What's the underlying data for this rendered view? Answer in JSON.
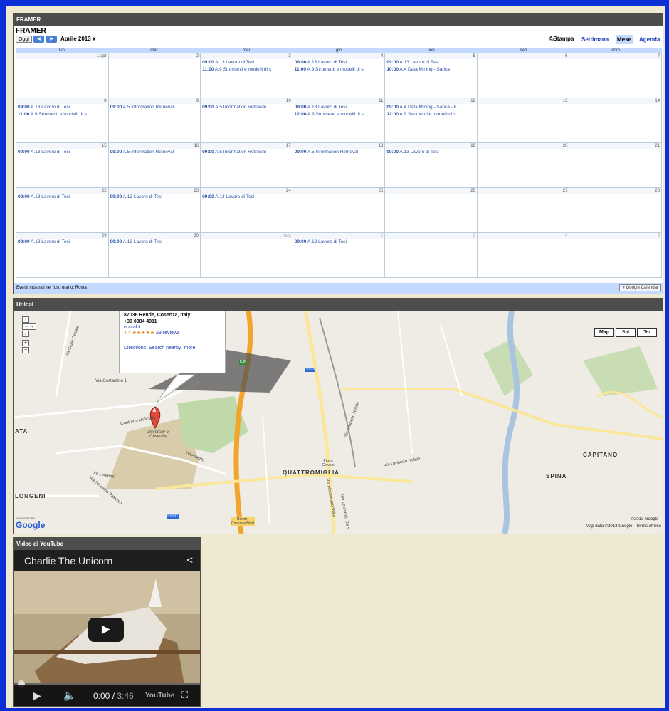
{
  "calendar": {
    "header": "FRAMER",
    "title": "FRAMER",
    "today_label": "Oggi",
    "month_label": "Aprile 2013",
    "print_label": "Stampa",
    "views": [
      "Settimana",
      "Mese",
      "Agenda"
    ],
    "active_view": "Mese",
    "weekdays": [
      "lun",
      "mar",
      "mer",
      "gio",
      "ven",
      "sab",
      "dom"
    ],
    "weeks": [
      [
        {
          "num": "1 apr",
          "events": []
        },
        {
          "num": "2",
          "events": []
        },
        {
          "num": "3",
          "events": [
            {
              "time": "09:00",
              "title": "A.13 Lavoro di Tesi"
            },
            {
              "time": "11:00",
              "title": "A.9 Strumenti e modelli di s"
            }
          ]
        },
        {
          "num": "4",
          "events": [
            {
              "time": "09:00",
              "title": "A.13 Lavoro di Tesi"
            },
            {
              "time": "11:00",
              "title": "A.9 Strumenti e modelli di s"
            }
          ]
        },
        {
          "num": "5",
          "events": [
            {
              "time": "09:00",
              "title": "A.13 Lavoro di Tesi"
            },
            {
              "time": "10:00",
              "title": "A.4 Data Mining - Sarica"
            }
          ]
        },
        {
          "num": "6",
          "events": []
        },
        {
          "num": "7",
          "events": []
        }
      ],
      [
        {
          "num": "8",
          "events": [
            {
              "time": "09:00",
              "title": "A.13 Lavoro di Tesi"
            },
            {
              "time": "11:00",
              "title": "A.9 Strumenti e modelli di s"
            }
          ]
        },
        {
          "num": "9",
          "events": [
            {
              "time": "09:00",
              "title": "A.5 Information Retrieval"
            }
          ]
        },
        {
          "num": "10",
          "events": [
            {
              "time": "09:00",
              "title": "A.5 Information Retrieval"
            }
          ]
        },
        {
          "num": "11",
          "events": [
            {
              "time": "09:00",
              "title": "A.13 Lavoro di Tesi"
            },
            {
              "time": "12:00",
              "title": "A.9 Strumenti e modelli di s"
            }
          ]
        },
        {
          "num": "12",
          "events": [
            {
              "time": "09:00",
              "title": "A.4 Data Mining - Sarica - F"
            },
            {
              "time": "12:00",
              "title": "A.9 Strumenti e modelli di s"
            }
          ]
        },
        {
          "num": "13",
          "events": []
        },
        {
          "num": "14",
          "events": []
        }
      ],
      [
        {
          "num": "15",
          "events": [
            {
              "time": "09:00",
              "title": "A.13 Lavoro di Tesi"
            }
          ]
        },
        {
          "num": "16",
          "events": [
            {
              "time": "09:00",
              "title": "A.5 Information Retrieval"
            }
          ]
        },
        {
          "num": "17",
          "events": [
            {
              "time": "09:00",
              "title": "A.5 Information Retrieval"
            }
          ]
        },
        {
          "num": "18",
          "events": [
            {
              "time": "09:00",
              "title": "A.5 Information Retrieval"
            }
          ]
        },
        {
          "num": "19",
          "events": [
            {
              "time": "09:00",
              "title": "A.13 Lavoro di Tesi"
            }
          ]
        },
        {
          "num": "20",
          "events": []
        },
        {
          "num": "21",
          "events": []
        }
      ],
      [
        {
          "num": "22",
          "events": [
            {
              "time": "09:00",
              "title": "A.13 Lavoro di Tesi"
            }
          ]
        },
        {
          "num": "23",
          "events": [
            {
              "time": "09:00",
              "title": "A.13 Lavoro di Tesi"
            }
          ]
        },
        {
          "num": "24",
          "events": [
            {
              "time": "09:00",
              "title": "A.13 Lavoro di Tesi"
            }
          ]
        },
        {
          "num": "25",
          "events": []
        },
        {
          "num": "26",
          "events": []
        },
        {
          "num": "27",
          "events": []
        },
        {
          "num": "28",
          "events": []
        }
      ],
      [
        {
          "num": "29",
          "events": [
            {
              "time": "09:00",
              "title": "A.13 Lavoro di Tesi"
            }
          ]
        },
        {
          "num": "30",
          "events": [
            {
              "time": "09:00",
              "title": "A.13 Lavoro di Tesi"
            }
          ]
        },
        {
          "num": "1 mag",
          "other": true,
          "events": []
        },
        {
          "num": "2",
          "other": true,
          "events": [
            {
              "time": "09:00",
              "title": "A.13 Lavoro di Tesi"
            }
          ]
        },
        {
          "num": "3",
          "other": true,
          "events": []
        },
        {
          "num": "4",
          "other": true,
          "events": []
        },
        {
          "num": "5",
          "other": true,
          "events": []
        }
      ]
    ],
    "footer": "Eventi mostrati nel fuso orario: Roma",
    "gcal_badge": "Google Calendar"
  },
  "map": {
    "header": "Unical",
    "info": {
      "address": "87036 Rende, Cosenza, Italy",
      "phone": "+39 0984 4911",
      "site": "unical.it",
      "rating": "4.4 ★★★★★",
      "reviews": "29 reviews",
      "directions": "Directions",
      "search_nearby": "Search nearby",
      "more": "more"
    },
    "map_types": [
      "Map",
      "Sat",
      "Ter"
    ],
    "active_type": "Map",
    "marker": "A",
    "labels": {
      "university": "University of Cosenza",
      "quattromiglia": "QUATTROMIGLIA",
      "capitano": "CAPITANO",
      "spina": "SPINA",
      "longeni": "LONGENI",
      "ata": "ATA",
      "umberto_nobile": "Via Umberto Nobile",
      "via_umberto_nobile": "Via Umberto Nobile",
      "giulio_cesare": "Via Giulio Cesare",
      "costantino": "Via Costantino 1",
      "molicelle": "Contrada Molicelle",
      "alberto": "Via Alberto",
      "longeni_road": "Via Longeni",
      "severino": "Via Severino Palermo",
      "rende_cosenza": "Rende-Cosenza Nord",
      "alessandro_volta": "Via Alessandro Volta",
      "leonardo": "Via Leonardo Da V",
      "parco": "Parco Giovani",
      "ss19": "SS19",
      "e45": "E45",
      "ss107": "SS107"
    },
    "copyright_line1": "©2013 Google -",
    "copyright_line2": "Map data ©2013 Google - Terms of Use",
    "google_logo": "Google",
    "powered_by": "POWERED BY"
  },
  "youtube": {
    "header": "Video di YouTube",
    "title": "Charlie The Unicorn",
    "current_time": "0:00",
    "duration": "3:46",
    "logo": "YouTube",
    "progress": 0
  }
}
